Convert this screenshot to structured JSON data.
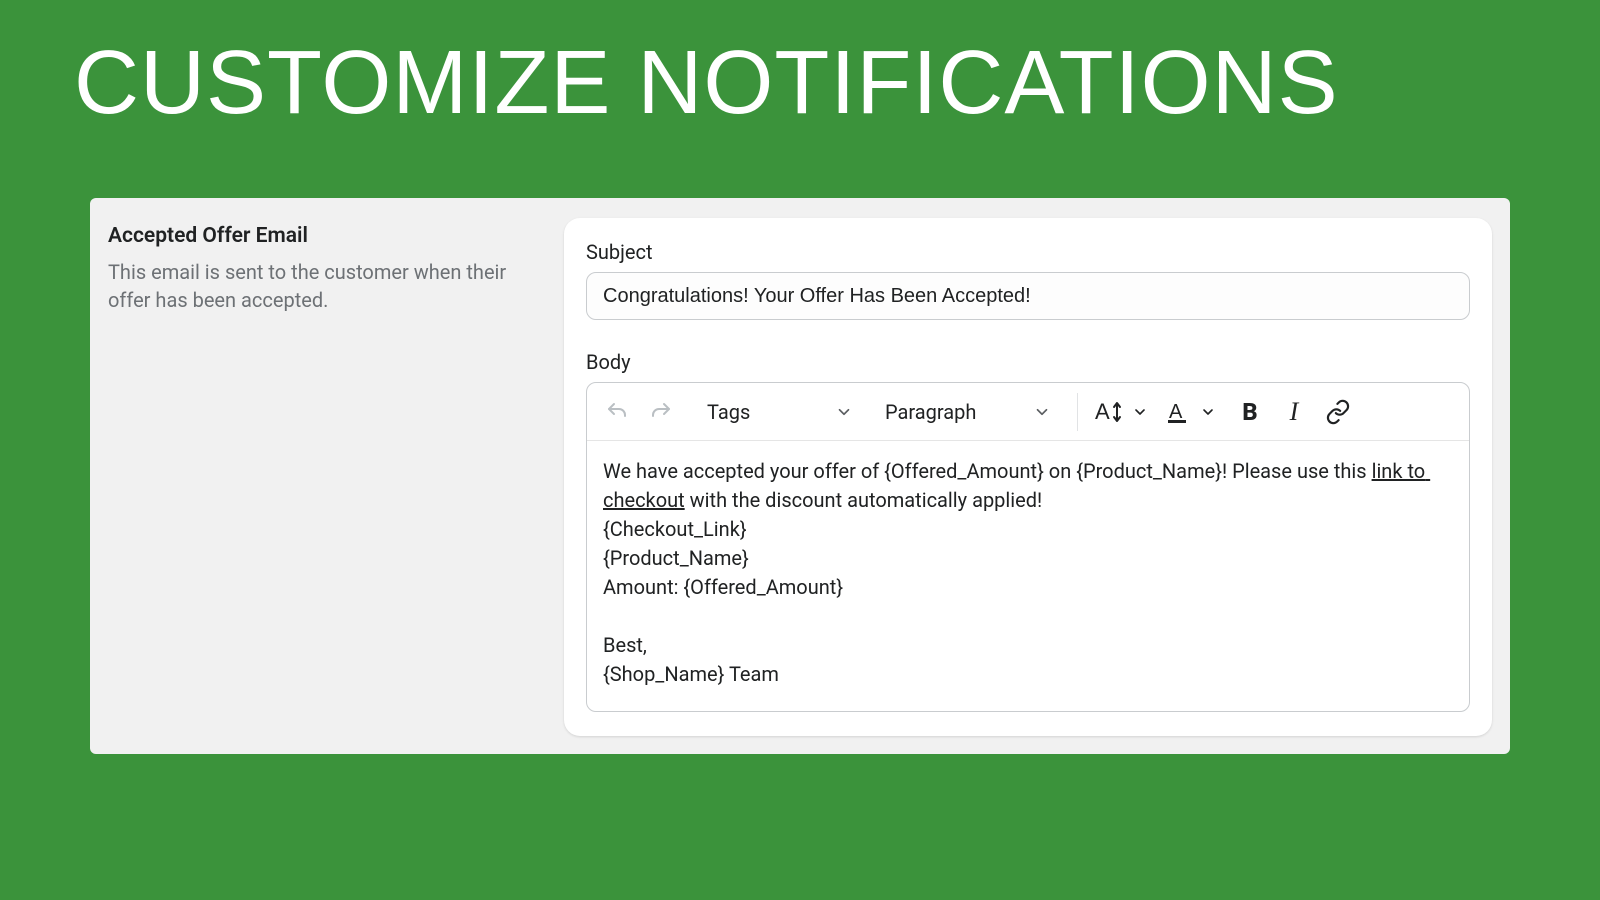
{
  "page_title": "Customize Notifications",
  "section": {
    "title": "Accepted Offer Email",
    "description": "This email is sent to the customer when their offer has been accepted."
  },
  "form": {
    "subject_label": "Subject",
    "subject_value": "Congratulations! Your Offer Has Been Accepted!",
    "body_label": "Body"
  },
  "toolbar": {
    "tags_label": "Tags",
    "paragraph_label": "Paragraph",
    "font_size_label": "A",
    "font_color_label": "A",
    "bold_label": "B",
    "italic_label": "I"
  },
  "body": {
    "p1_a": "We have accepted your offer of {Offered_Amount} on {Product_Name}! Please use this ",
    "p1_link": "link to checkout",
    "p1_b": " with the discount automatically applied!",
    "l2": "{Checkout_Link}",
    "l3": "{Product_Name}",
    "l4": "Amount: {Offered_Amount}",
    "blank": "",
    "l5": "Best,",
    "l6": "{Shop_Name} Team"
  }
}
